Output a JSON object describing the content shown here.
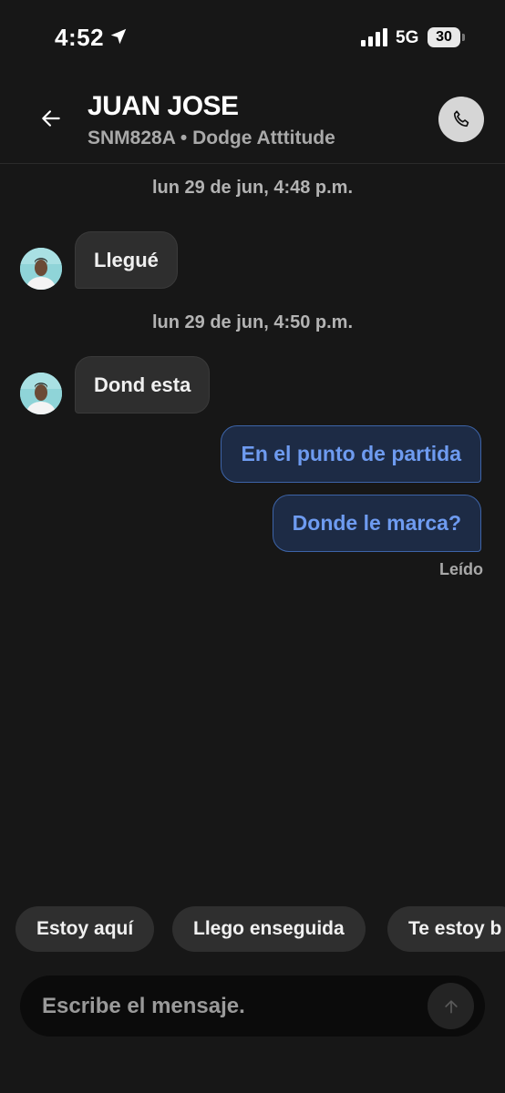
{
  "status_bar": {
    "time": "4:52",
    "network": "5G",
    "battery": "30",
    "icons": [
      "location-arrow-icon",
      "signal-bars-icon",
      "battery-icon"
    ]
  },
  "header": {
    "name": "JUAN JOSE",
    "subtitle": "SNM828A • Dodge Atttitude",
    "icons": [
      "back-arrow-icon",
      "phone-icon"
    ]
  },
  "messages": {
    "ts1": "lun 29 de jun, 4:48 p.m.",
    "msg1": "Llegué",
    "ts2": "lun 29 de jun, 4:50 p.m.",
    "msg2": "Dond esta",
    "msg3": "En el punto de partida",
    "msg4": "Donde le marca?",
    "read_status": "Leído"
  },
  "quick_replies": [
    "Estoy aquí",
    "Llego enseguida",
    "Te estoy b"
  ],
  "composer": {
    "placeholder": "Escribe el mensaje.",
    "value": ""
  },
  "colors": {
    "background": "#171717",
    "incoming_bubble": "#2e2e2e",
    "outgoing_bubble": "#1d2b45",
    "outgoing_text": "#6e9bf0",
    "outgoing_border": "#3d64a8"
  }
}
